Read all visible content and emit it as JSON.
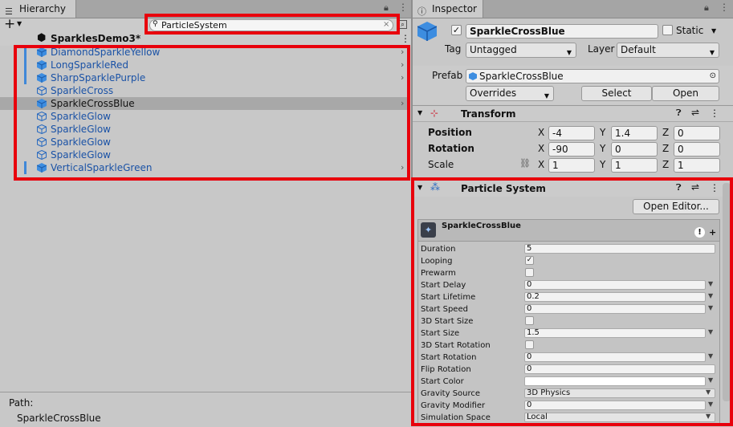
{
  "hierarchy": {
    "tab_label": "Hierarchy",
    "add_label": "+",
    "search_value": "ParticleSystem",
    "scene_name": "SparklesDemo3*",
    "items": [
      {
        "label": "DiamondSparkleYellow"
      },
      {
        "label": "LongSparkleRed"
      },
      {
        "label": "SharpSparklePurple"
      },
      {
        "label": "SparkleCross"
      },
      {
        "label": "SparkleCrossBlue"
      },
      {
        "label": "SparkleGlow"
      },
      {
        "label": "SparkleGlow"
      },
      {
        "label": "SparkleGlow"
      },
      {
        "label": "SparkleGlow"
      },
      {
        "label": "VerticalSparkleGreen"
      }
    ],
    "path_label": "Path:",
    "path_value": "SparkleCrossBlue"
  },
  "inspector": {
    "tab_label": "Inspector",
    "object_name": "SparkleCrossBlue",
    "static_label": "Static",
    "tag_label": "Tag",
    "tag_value": "Untagged",
    "layer_label": "Layer",
    "layer_value": "Default",
    "prefab_label": "Prefab",
    "prefab_value": "SparkleCrossBlue",
    "overrides_label": "Overrides",
    "select_label": "Select",
    "open_label": "Open",
    "transform": {
      "title": "Transform",
      "position_label": "Position",
      "rotation_label": "Rotation",
      "scale_label": "Scale",
      "x": "X",
      "y": "Y",
      "z": "Z",
      "position": [
        "-4",
        "1.4",
        "0"
      ],
      "rotation": [
        "-90",
        "0",
        "0"
      ],
      "scale": [
        "1",
        "1",
        "1"
      ]
    },
    "particle_system": {
      "title": "Particle System",
      "open_editor_label": "Open Editor...",
      "module_name": "SparkleCrossBlue",
      "rows": {
        "duration": {
          "label": "Duration",
          "value": "5"
        },
        "looping": {
          "label": "Looping",
          "value": "✓"
        },
        "prewarm": {
          "label": "Prewarm",
          "value": ""
        },
        "start_delay": {
          "label": "Start Delay",
          "value": "0"
        },
        "start_lifetime": {
          "label": "Start Lifetime",
          "value": "0.2"
        },
        "start_speed": {
          "label": "Start Speed",
          "value": "0"
        },
        "start_size_3d": {
          "label": "3D Start Size",
          "value": ""
        },
        "start_size": {
          "label": "Start Size",
          "value": "1.5"
        },
        "start_rotation_3d": {
          "label": "3D Start Rotation",
          "value": ""
        },
        "start_rotation": {
          "label": "Start Rotation",
          "value": "0"
        },
        "flip_rotation": {
          "label": "Flip Rotation",
          "value": "0"
        },
        "start_color": {
          "label": "Start Color",
          "value": ""
        },
        "gravity_source": {
          "label": "Gravity Source",
          "value": "3D Physics"
        },
        "gravity_modifier": {
          "label": "Gravity Modifier",
          "value": "0"
        },
        "simulation_space": {
          "label": "Simulation Space",
          "value": "Local"
        }
      }
    }
  },
  "colors": {
    "highlight": "#e8000c",
    "link_blue": "#1a52a6",
    "panel_bg": "#c8c8c8"
  }
}
